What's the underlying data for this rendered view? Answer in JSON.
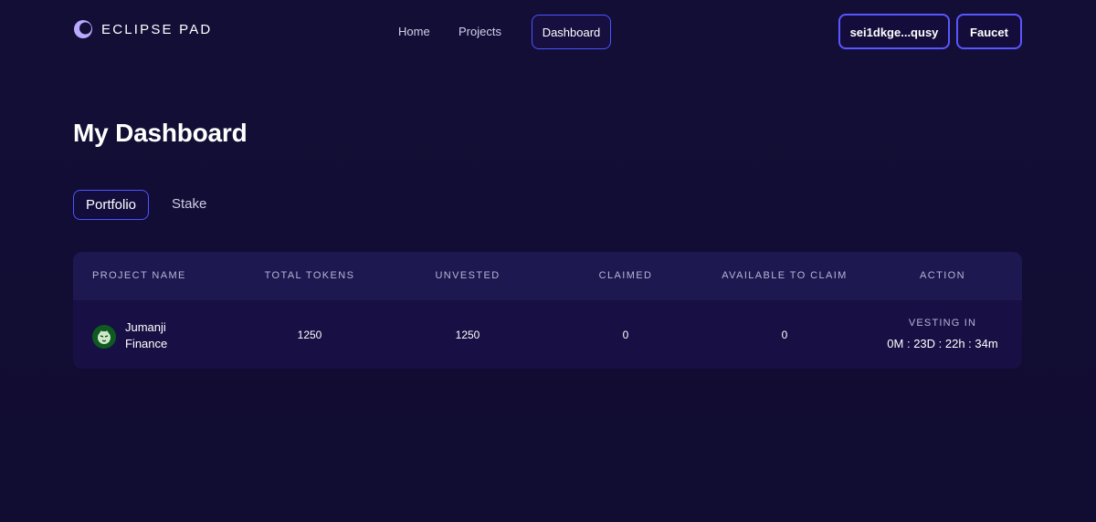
{
  "brand": {
    "name": "ECLIPSE PAD"
  },
  "nav": {
    "home": "Home",
    "projects": "Projects",
    "dashboard": "Dashboard"
  },
  "header_actions": {
    "wallet": "sei1dkge...qusy",
    "faucet": "Faucet"
  },
  "page": {
    "title": "My Dashboard"
  },
  "tabs": [
    {
      "label": "Portfolio",
      "active": true
    },
    {
      "label": "Stake",
      "active": false
    }
  ],
  "table": {
    "headers": [
      "PROJECT NAME",
      "TOTAL TOKENS",
      "UNVESTED",
      "CLAIMED",
      "AVAILABLE TO CLAIM",
      "ACTION"
    ],
    "rows": [
      {
        "project_name": "Jumanji Finance",
        "total_tokens": "1250",
        "unvested": "1250",
        "claimed": "0",
        "available_to_claim": "0",
        "action_label": "VESTING IN",
        "action_countdown": "0M : 23D : 22h : 34m"
      }
    ]
  },
  "colors": {
    "background": "#120d33",
    "accent_border": "#4b56ff",
    "table_header": "#1d1850",
    "table_row": "#181044"
  },
  "icons": {
    "logo": "eclipse-logo-icon",
    "project_avatar": "tiger-avatar-icon"
  }
}
